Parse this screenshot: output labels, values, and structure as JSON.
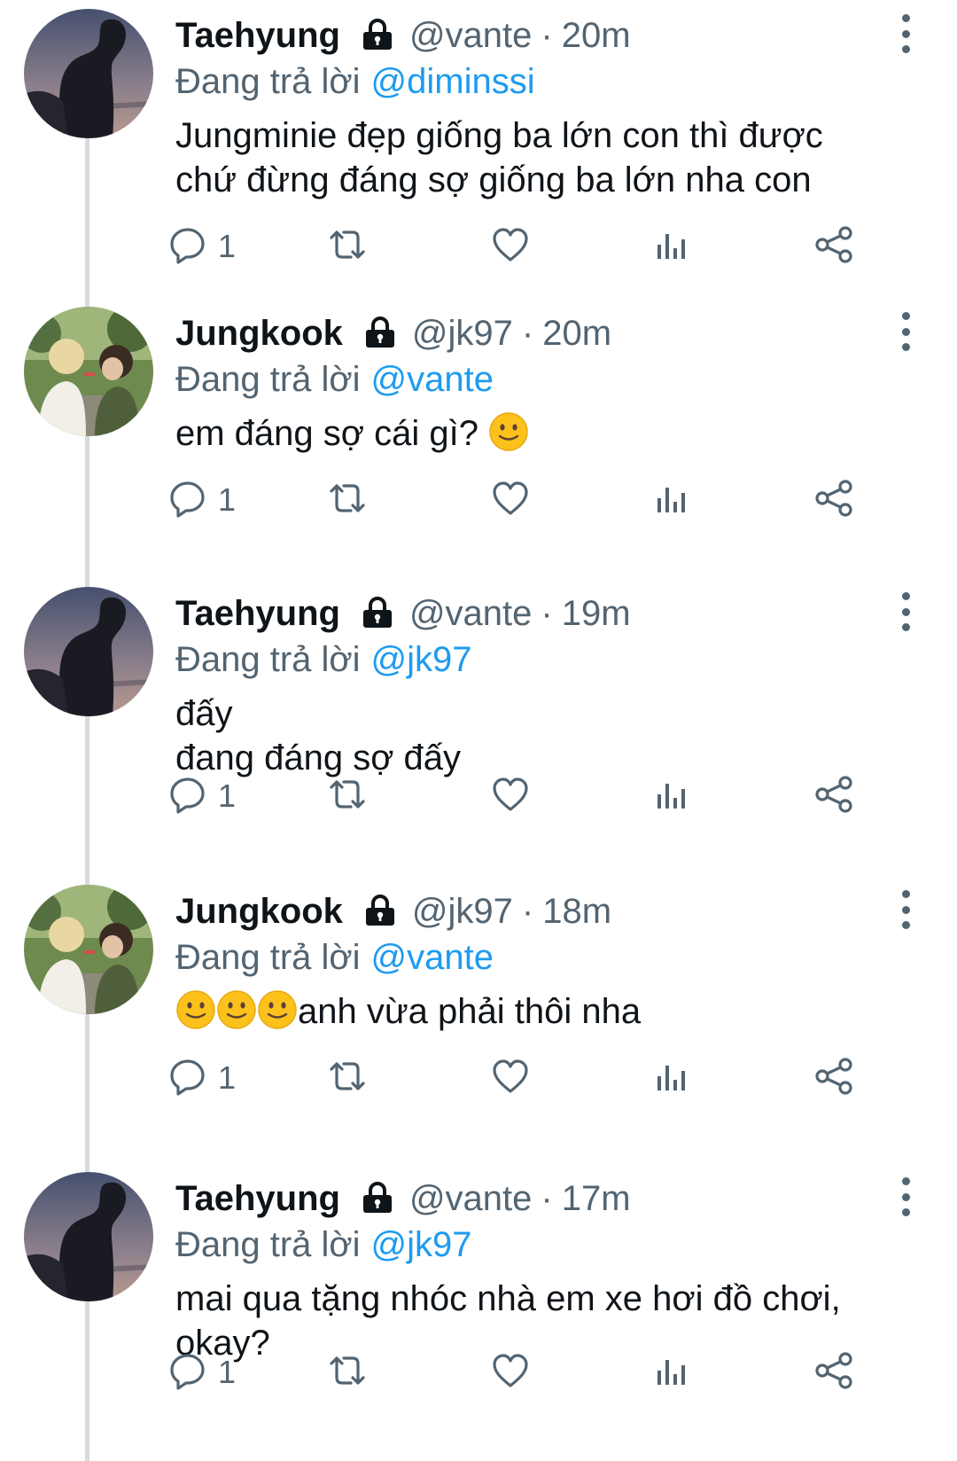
{
  "tweets": [
    {
      "name": "Taehyung",
      "handle": "@vante",
      "separator": "·",
      "time": "20m",
      "replying_prefix": "Đang trả lời",
      "replying_to": "@diminssi",
      "text_lines": [
        "Jungminie đẹp giống ba lớn con thì được",
        "chứ đừng đáng sợ giống ba lớn nha con"
      ],
      "reply_count": "1",
      "avatar": "avatar-taehyung"
    },
    {
      "name": "Jungkook",
      "handle": "@jk97",
      "separator": "·",
      "time": "20m",
      "replying_prefix": "Đang trả lời",
      "replying_to": "@vante",
      "text_lines": [
        "em đáng sợ cái gì?"
      ],
      "reply_count": "1",
      "avatar": "avatar-jungkook"
    },
    {
      "name": "Taehyung",
      "handle": "@vante",
      "separator": "·",
      "time": "19m",
      "replying_prefix": "Đang trả lời",
      "replying_to": "@jk97",
      "text_lines": [
        "đấy",
        "đang đáng sợ đấy"
      ],
      "reply_count": "1",
      "avatar": "avatar-taehyung"
    },
    {
      "name": "Jungkook",
      "handle": "@jk97",
      "separator": "·",
      "time": "18m",
      "replying_prefix": "Đang trả lời",
      "replying_to": "@vante",
      "text_lines": [
        "anh vừa phải thôi nha"
      ],
      "reply_count": "1",
      "avatar": "avatar-jungkook"
    },
    {
      "name": "Taehyung",
      "handle": "@vante",
      "separator": "·",
      "time": "17m",
      "replying_prefix": "Đang trả lời",
      "replying_to": "@jk97",
      "text_lines": [
        "mai qua tặng nhóc nhà em xe hơi đồ chơi,",
        "okay?"
      ],
      "reply_count": "1",
      "avatar": "avatar-taehyung"
    }
  ],
  "icons": {
    "lock": "lock-icon",
    "more": "more-vertical-icon",
    "reply": "reply-icon",
    "retweet": "retweet-icon",
    "like": "heart-icon",
    "views": "views-icon",
    "share": "share-icon",
    "emoji": "slightly-smiling-emoji-icon"
  },
  "colors": {
    "accent": "#1d9bf0",
    "muted": "#536471",
    "text": "#0f1419",
    "thread": "#d6dbe0"
  }
}
